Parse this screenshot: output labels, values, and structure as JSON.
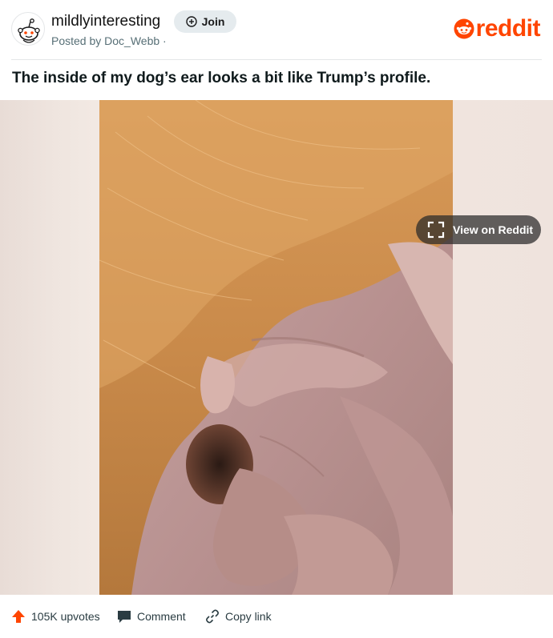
{
  "header": {
    "subreddit": "mildlyinteresting",
    "posted_by": "Posted by Doc_Webb ·",
    "join_label": "Join",
    "avatar_icon": "snoo-avatar-icon",
    "brand": {
      "word": "reddit",
      "color": "#ff4500"
    }
  },
  "post": {
    "title": "The inside of my dog’s ear looks a bit like Trump’s profile.",
    "image_alt": "Close-up photo of the inside of a dog's ear with ginger fur"
  },
  "media": {
    "view_label": "View on Reddit",
    "view_icon": "expand-icon"
  },
  "footer": {
    "upvotes": "105K upvotes",
    "comment": "Comment",
    "copy_link": "Copy link",
    "upvote_icon": "upvote-arrow-icon",
    "comment_icon": "comment-bubble-icon",
    "link_icon": "link-icon"
  },
  "colors": {
    "accent": "#ff4500",
    "join_bg": "#e5ebee",
    "overlay": "#282828",
    "text_secondary": "#576f76"
  }
}
